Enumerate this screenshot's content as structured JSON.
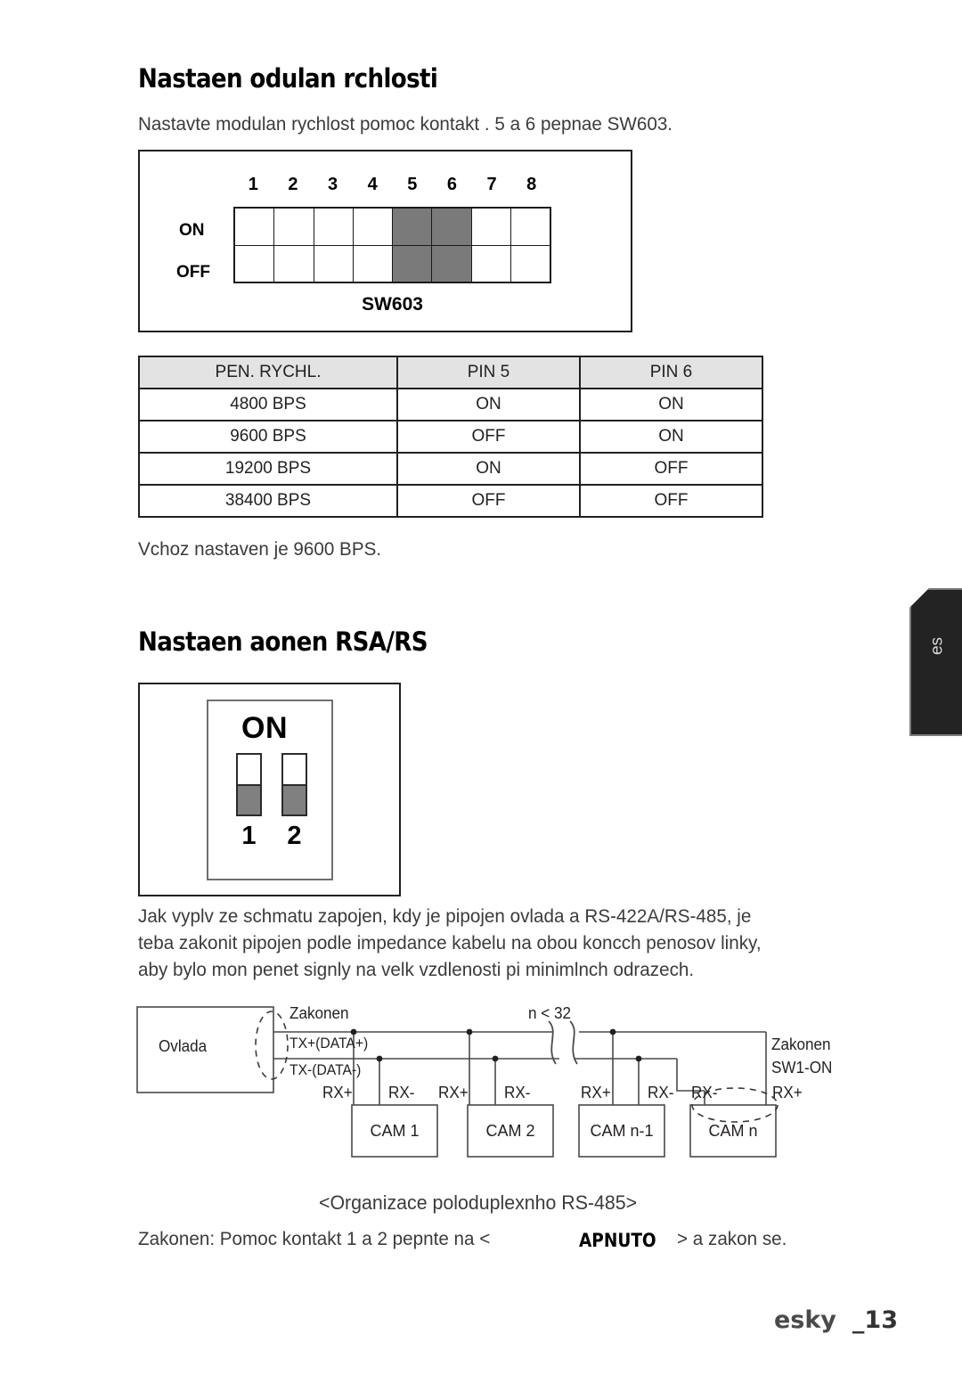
{
  "page": {
    "footer_label": "esky",
    "footer_page": "_13",
    "side_tab": "es"
  },
  "section_baud": {
    "heading": "Nastaen odulan rchlosti",
    "intro": "Nastavte modulan rychlost pomoc kontakt . 5 a 6 pepnae SW603.",
    "default_note": "Vchoz nastaven je 9600 BPS.",
    "dip_switch": {
      "caption": "SW603",
      "row_labels": [
        "ON",
        "OFF"
      ],
      "numbers": [
        "1",
        "2",
        "3",
        "4",
        "5",
        "6",
        "7",
        "8"
      ],
      "highlighted": [
        5,
        6
      ],
      "highlight_color": "#7a7a7a"
    },
    "table": {
      "headers": [
        "PEN. RYCHL.",
        "PIN 5",
        "PIN 6"
      ],
      "header_bg": "#e3e3e3",
      "rows": [
        [
          "4800 BPS",
          "ON",
          "ON"
        ],
        [
          "9600 BPS",
          "OFF",
          "ON"
        ],
        [
          "19200 BPS",
          "ON",
          "OFF"
        ],
        [
          "38400 BPS",
          "OFF",
          "OFF"
        ]
      ]
    }
  },
  "section_termination": {
    "heading": "Nastaen aonen RSA/RS",
    "dip2": {
      "on_label": "ON",
      "numbers": [
        "1",
        "2"
      ],
      "switch_fill": "#808080"
    },
    "paragraph": [
      "Jak vyplv ze schmatu zapojen, kdy je pipojen ovlada a RS-422A/RS-485, je",
      "teba zakonit pipojen podle impedance kabelu na obou koncch penosov linky,",
      "aby bylo mon penet signly na velk vzdlenosti pi minimlnch odrazech."
    ],
    "diagram": {
      "controller": "Ovlada",
      "termination_left": "Zakonen",
      "tx_plus": "TX+(DATA+)",
      "tx_minus": "TX-(DATA-)",
      "limit": "n < 32",
      "termination_right_1": "Zakonen",
      "termination_right_2": "SW1-ON",
      "cams": [
        "CAM 1",
        "CAM 2",
        "CAM n-1",
        "CAM n"
      ],
      "rx_labels": [
        "RX+",
        "RX-",
        "RX+",
        "RX-",
        "RX+",
        "RX-",
        "RX-",
        "RX+"
      ]
    },
    "caption": "<Organizace poloduplexnho RS-485>",
    "closing_pre": "Zakonen: Pomoc kontakt 1 a 2 pepnte na <",
    "closing_bold": "APNUTO",
    "closing_post": "> a zakon se."
  }
}
